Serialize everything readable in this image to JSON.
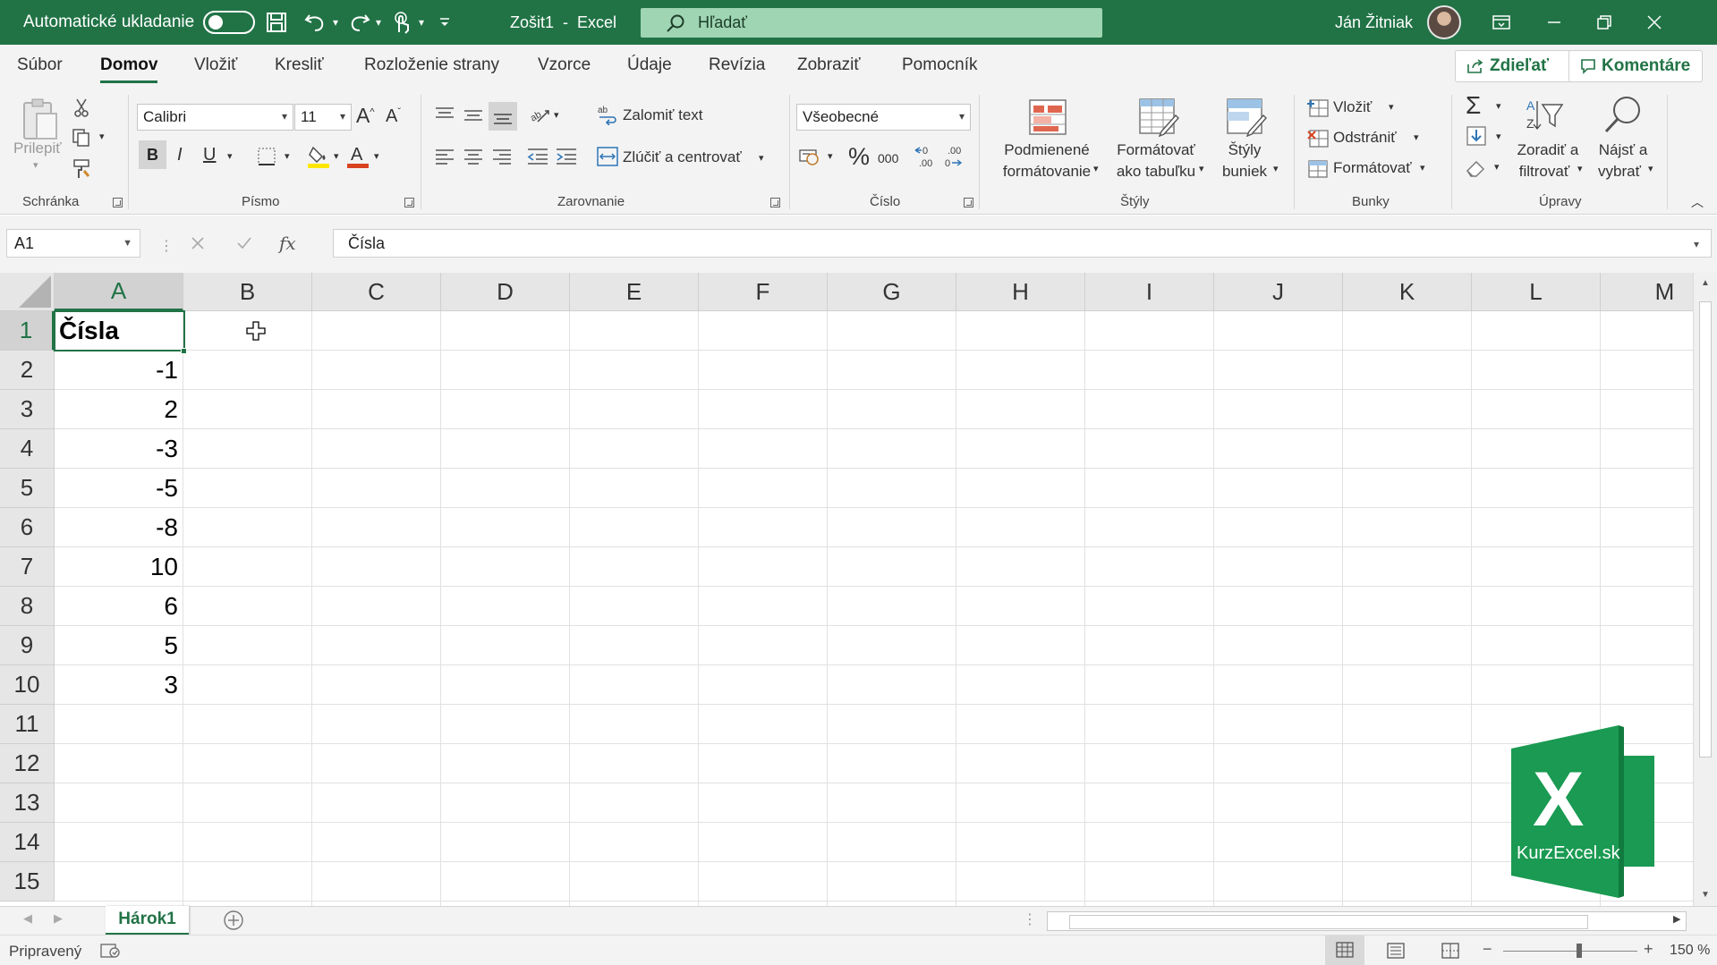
{
  "titlebar": {
    "autosave_label": "Automatické ukladanie",
    "doc_title": "Zošit1  -  Excel",
    "search_placeholder": "Hľadať",
    "user_name": "Ján Žitniak"
  },
  "tabs": [
    "Súbor",
    "Domov",
    "Vložiť",
    "Kresliť",
    "Rozloženie strany",
    "Vzorce",
    "Údaje",
    "Revízia",
    "Zobraziť",
    "Pomocník"
  ],
  "active_tab": "Domov",
  "share_label": "Zdieľať",
  "comments_label": "Komentáre",
  "ribbon": {
    "clipboard": {
      "label": "Schránka",
      "paste": "Prilepiť"
    },
    "font": {
      "label": "Písmo",
      "font_name": "Calibri",
      "font_size": "11",
      "bold": "B",
      "italic": "I",
      "underline": "U"
    },
    "alignment": {
      "label": "Zarovnanie",
      "wrap_text": "Zalomiť text",
      "merge_center": "Zlúčiť a centrovať"
    },
    "number": {
      "label": "Číslo",
      "format": "Všeobecné",
      "percent": "%",
      "thousands": "000",
      "inc_decimal": "←0 .00",
      "dec_decimal": ".00 →0"
    },
    "styles": {
      "label": "Štýly",
      "conditional_1": "Podmienené",
      "conditional_2": "formátovanie",
      "format_table_1": "Formátovať",
      "format_table_2": "ako tabuľku",
      "cell_styles_1": "Štýly",
      "cell_styles_2": "buniek"
    },
    "cells": {
      "label": "Bunky",
      "insert": "Vložiť",
      "delete": "Odstrániť",
      "format": "Formátovať"
    },
    "editing": {
      "label": "Úpravy",
      "sort_1": "Zoradiť a",
      "sort_2": "filtrovať",
      "find_1": "Nájsť a",
      "find_2": "vybrať"
    }
  },
  "formula_bar": {
    "name_box": "A1",
    "fx": "fx",
    "content": "Čísla"
  },
  "columns": [
    "A",
    "B",
    "C",
    "D",
    "E",
    "F",
    "G",
    "H",
    "I",
    "J",
    "K",
    "L",
    "M"
  ],
  "rows": [
    "1",
    "2",
    "3",
    "4",
    "5",
    "6",
    "7",
    "8",
    "9",
    "10",
    "11",
    "12",
    "13",
    "14",
    "15"
  ],
  "cells": {
    "A1": "Čísla",
    "A_values": [
      "-1",
      "2",
      "-3",
      "-5",
      "-8",
      "10",
      "6",
      "5",
      "3"
    ]
  },
  "selected_cell": "A1",
  "sheet_tab": "Hárok1",
  "status": {
    "ready": "Pripravený",
    "zoom": "150 %"
  },
  "logo": {
    "letter": "X",
    "text": "KurzExcel.sk"
  },
  "colors": {
    "accent": "#217346",
    "search_bg": "#9fd5b3",
    "logo_green": "#1a9a52"
  }
}
